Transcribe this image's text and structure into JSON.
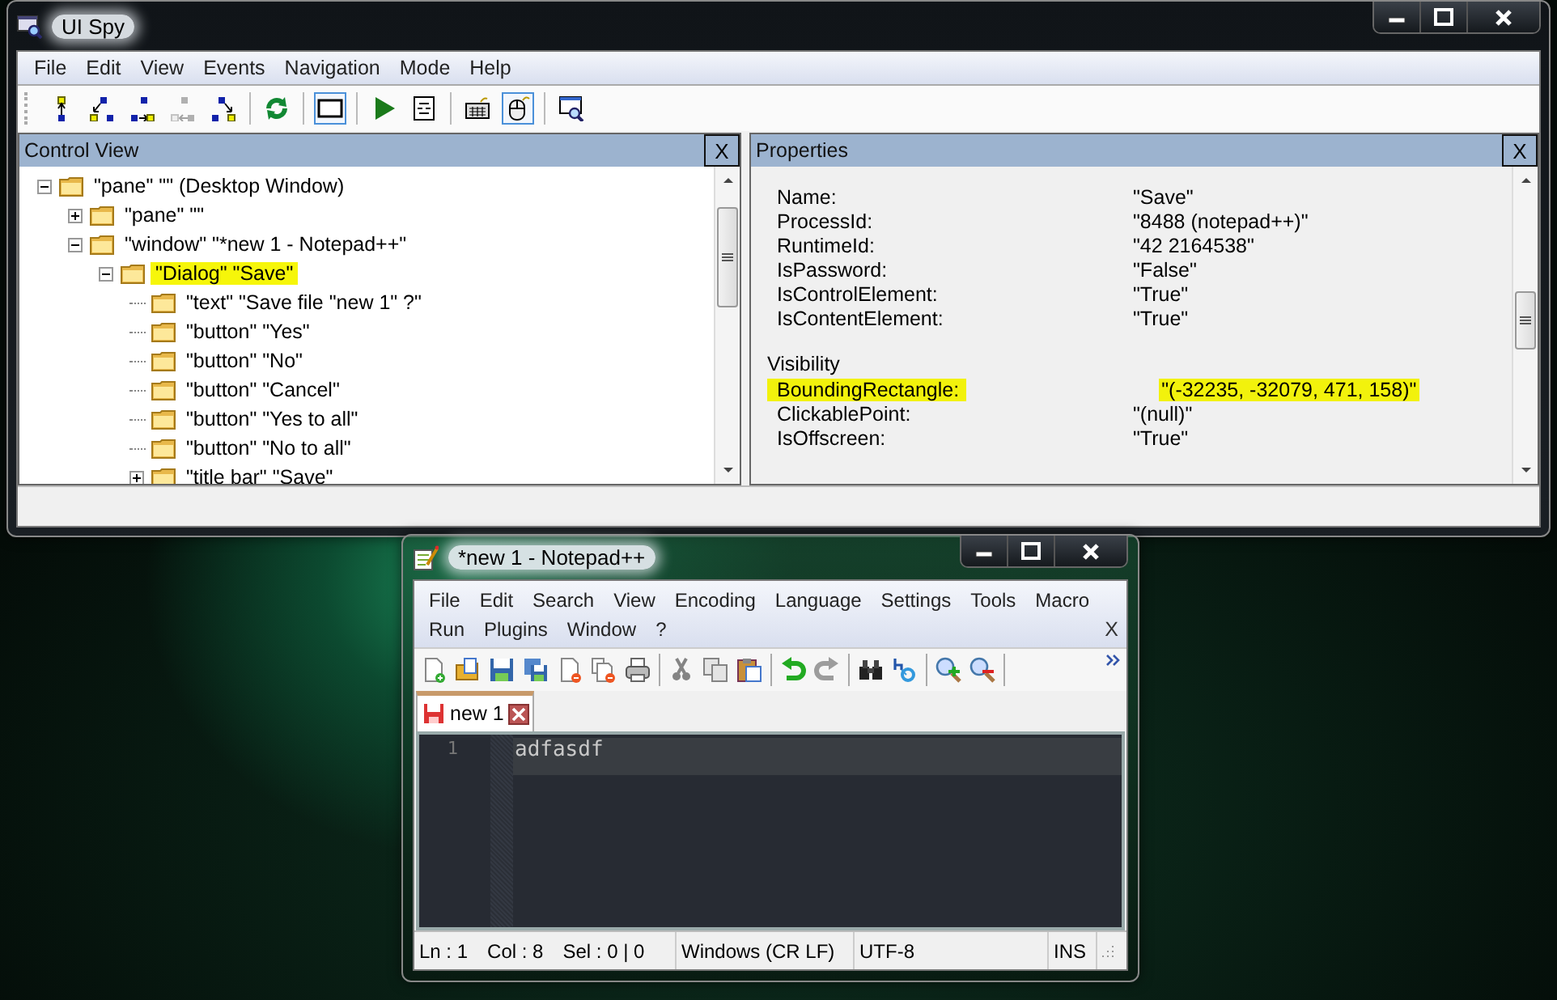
{
  "ui_spy": {
    "title": "UI Spy",
    "menu": [
      "File",
      "Edit",
      "View",
      "Events",
      "Navigation",
      "Mode",
      "Help"
    ],
    "toolbar": [
      {
        "group": [
          {
            "pressed": false,
            "disabled": false
          },
          {
            "pressed": false,
            "disabled": false
          },
          {
            "pressed": false,
            "disabled": false
          },
          {
            "pressed": false,
            "disabled": true
          },
          {
            "pressed": false,
            "disabled": false
          }
        ]
      },
      {
        "group": [
          {
            "pressed": false,
            "disabled": false
          }
        ]
      },
      {
        "group": [
          {
            "pressed": true,
            "disabled": false
          }
        ]
      },
      {
        "group": [
          {
            "pressed": false,
            "disabled": false
          },
          {
            "pressed": false,
            "disabled": false
          }
        ]
      },
      {
        "group": [
          {
            "pressed": false,
            "disabled": false
          },
          {
            "pressed": true,
            "disabled": false
          }
        ]
      },
      {
        "group": [
          {
            "pressed": false,
            "disabled": false
          }
        ]
      }
    ],
    "control_view": {
      "title": "Control View",
      "close": "X",
      "tree": [
        {
          "label": "\"pane\" \"\" (Desktop Window)",
          "kind": "expanded",
          "selected": false,
          "children": [
            {
              "label": "\"pane\" \"\"",
              "kind": "collapsed",
              "selected": false
            },
            {
              "label": "\"window\" \"*new 1 - Notepad++\"",
              "kind": "expanded",
              "selected": false,
              "children": [
                {
                  "label": "\"Dialog\" \"Save\"",
                  "kind": "expanded",
                  "selected": true,
                  "children": [
                    {
                      "label": "\"text\" \"Save file \"new 1\" ?\"",
                      "kind": "leaf",
                      "selected": false
                    },
                    {
                      "label": "\"button\" \"Yes\"",
                      "kind": "leaf",
                      "selected": false
                    },
                    {
                      "label": "\"button\" \"No\"",
                      "kind": "leaf",
                      "selected": false
                    },
                    {
                      "label": "\"button\" \"Cancel\"",
                      "kind": "leaf",
                      "selected": false
                    },
                    {
                      "label": "\"button\" \"Yes to all\"",
                      "kind": "leaf",
                      "selected": false
                    },
                    {
                      "label": "\"button\" \"No to all\"",
                      "kind": "leaf",
                      "selected": false
                    },
                    {
                      "label": "\"title bar\" \"Save\"",
                      "kind": "collapsed",
                      "selected": false
                    }
                  ]
                }
              ]
            }
          ]
        }
      ]
    },
    "properties": {
      "title": "Properties",
      "close": "X",
      "rows": [
        {
          "kind": "property",
          "name": "Name:",
          "value": "\"Save\"",
          "highlighted": false
        },
        {
          "kind": "property",
          "name": "ProcessId:",
          "value": "\"8488 (notepad++)\"",
          "highlighted": false
        },
        {
          "kind": "property",
          "name": "RuntimeId:",
          "value": "\"42 2164538\"",
          "highlighted": false
        },
        {
          "kind": "property",
          "name": "IsPassword:",
          "value": "\"False\"",
          "highlighted": false
        },
        {
          "kind": "property",
          "name": "IsControlElement:",
          "value": "\"True\"",
          "highlighted": false
        },
        {
          "kind": "property",
          "name": "IsContentElement:",
          "value": "\"True\"",
          "highlighted": false
        },
        {
          "kind": "group",
          "name": "Visibility"
        },
        {
          "kind": "property",
          "name": "BoundingRectangle:",
          "value": "\"(-32235, -32079, 471, 158)\"",
          "highlighted": true
        },
        {
          "kind": "property",
          "name": "ClickablePoint:",
          "value": "\"(null)\"",
          "highlighted": false
        },
        {
          "kind": "property",
          "name": "IsOffscreen:",
          "value": "\"True\"",
          "highlighted": false
        }
      ]
    }
  },
  "notepad": {
    "title": "*new 1 - Notepad++",
    "menu_rows": [
      [
        "File",
        "Edit",
        "Search",
        "View",
        "Encoding",
        "Language",
        "Settings",
        "Tools",
        "Macro"
      ],
      [
        "Run",
        "Plugins",
        "Window",
        "?"
      ]
    ],
    "close_document": "X",
    "toolbar": [
      {
        "group": [
          {
            "disabled": false
          },
          {
            "disabled": false
          },
          {
            "disabled": false
          },
          {
            "disabled": false
          },
          {
            "disabled": false
          },
          {
            "disabled": false
          },
          {
            "disabled": false
          }
        ]
      },
      {
        "group": [
          {
            "disabled": true
          },
          {
            "disabled": true
          },
          {
            "disabled": false
          }
        ]
      },
      {
        "group": [
          {
            "disabled": false
          },
          {
            "disabled": true
          }
        ]
      },
      {
        "group": [
          {
            "disabled": false
          },
          {
            "disabled": false
          }
        ]
      },
      {
        "group": [
          {
            "disabled": false
          },
          {
            "disabled": false
          }
        ]
      }
    ],
    "tabs": [
      {
        "label": "new 1",
        "selected": true,
        "modified": true
      }
    ],
    "editor": {
      "lines": [
        {
          "number": "1",
          "text": "adfasdf",
          "current": true
        }
      ]
    },
    "status_bar": {
      "position": [
        "Ln : 1",
        "Col : 8",
        "Sel : 0 | 0"
      ],
      "eol": "Windows (CR LF)",
      "encoding": "UTF-8",
      "mode": "INS"
    }
  }
}
